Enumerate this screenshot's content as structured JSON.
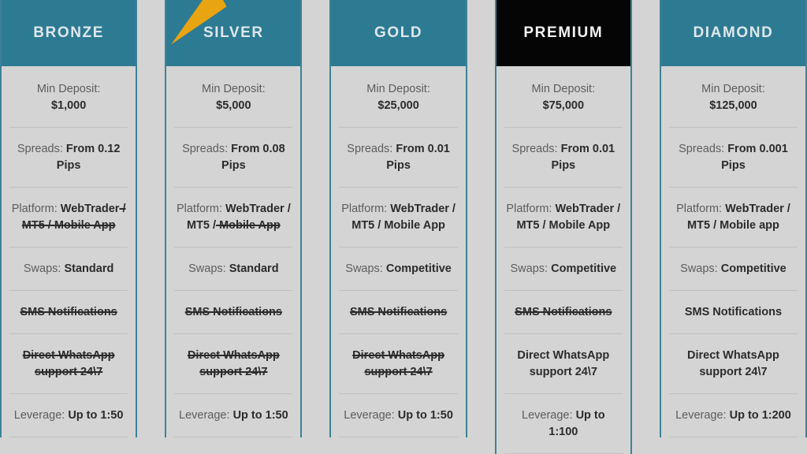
{
  "theme": {
    "header_teal": "#2d7a93",
    "header_dark": "#050505",
    "page_background": "#d4d4d4",
    "card_border": "#3c8296",
    "divider": "#c0c0c0",
    "accent_orange": "#e9a411",
    "label_text": "#5d5d5d",
    "value_text": "#2b2b2b"
  },
  "plans": [
    {
      "name": "BRONZE",
      "header_style": "teal",
      "has_wedge_icon": false,
      "features": {
        "min_deposit_label": "Min Deposit:",
        "min_deposit_value": "$1,000",
        "spreads_label": "Spreads: ",
        "spreads_value": "From 0.12 Pips",
        "platform_label": "Platform: ",
        "platform_available": "WebTrader",
        "platform_unavailable": " / MT5 / Mobile App",
        "swaps_label": "Swaps: ",
        "swaps_value": "Standard",
        "sms": "SMS Notifications",
        "sms_struck": true,
        "whatsapp": "Direct WhatsApp support 24\\7",
        "whatsapp_struck": true,
        "leverage_label": "Leverage: ",
        "leverage_value": "Up to 1:50"
      }
    },
    {
      "name": "SILVER",
      "header_style": "teal",
      "has_wedge_icon": true,
      "features": {
        "min_deposit_label": "Min Deposit:",
        "min_deposit_value": "$5,000",
        "spreads_label": "Spreads: ",
        "spreads_value": "From 0.08 Pips",
        "platform_label": "Platform: ",
        "platform_available": "WebTrader / MT5 /",
        "platform_unavailable": " Mobile App",
        "swaps_label": "Swaps: ",
        "swaps_value": "Standard",
        "sms": "SMS Notifications",
        "sms_struck": true,
        "whatsapp": "Direct WhatsApp support 24\\7",
        "whatsapp_struck": true,
        "leverage_label": "Leverage: ",
        "leverage_value": "Up to 1:50"
      }
    },
    {
      "name": "GOLD",
      "header_style": "teal",
      "has_wedge_icon": false,
      "features": {
        "min_deposit_label": "Min Deposit:",
        "min_deposit_value": "$25,000",
        "spreads_label": "Spreads: ",
        "spreads_value": "From 0.01 Pips",
        "platform_label": "Platform: ",
        "platform_available": "WebTrader / MT5 / Mobile App",
        "platform_unavailable": "",
        "swaps_label": "Swaps: ",
        "swaps_value": "Competitive",
        "sms": "SMS Notifications",
        "sms_struck": true,
        "whatsapp": "Direct WhatsApp support 24\\7",
        "whatsapp_struck": true,
        "leverage_label": "Leverage: ",
        "leverage_value": "Up to 1:50"
      }
    },
    {
      "name": "PREMIUM",
      "header_style": "dark",
      "has_wedge_icon": false,
      "features": {
        "min_deposit_label": "Min Deposit:",
        "min_deposit_value": "$75,000",
        "spreads_label": "Spreads: ",
        "spreads_value": "From 0.01 Pips",
        "platform_label": "Platform: ",
        "platform_available": "WebTrader / MT5 / Mobile App",
        "platform_unavailable": "",
        "swaps_label": "Swaps: ",
        "swaps_value": "Competitive",
        "sms": "SMS Notifications",
        "sms_struck": true,
        "whatsapp": "Direct WhatsApp support 24\\7",
        "whatsapp_struck": false,
        "leverage_label": "Leverage: ",
        "leverage_value": "Up to 1:100"
      }
    },
    {
      "name": "DIAMOND",
      "header_style": "teal",
      "has_wedge_icon": false,
      "features": {
        "min_deposit_label": "Min Deposit:",
        "min_deposit_value": "$125,000",
        "spreads_label": "Spreads: ",
        "spreads_value": "From 0.001 Pips",
        "platform_label": "Platform: ",
        "platform_available": "WebTrader / MT5 / Mobile app",
        "platform_unavailable": "",
        "swaps_label": "Swaps: ",
        "swaps_value": "Competitive",
        "sms": "SMS Notifications",
        "sms_struck": false,
        "whatsapp": "Direct WhatsApp support 24\\7",
        "whatsapp_struck": false,
        "leverage_label": "Leverage: ",
        "leverage_value": "Up to 1:200"
      }
    }
  ]
}
